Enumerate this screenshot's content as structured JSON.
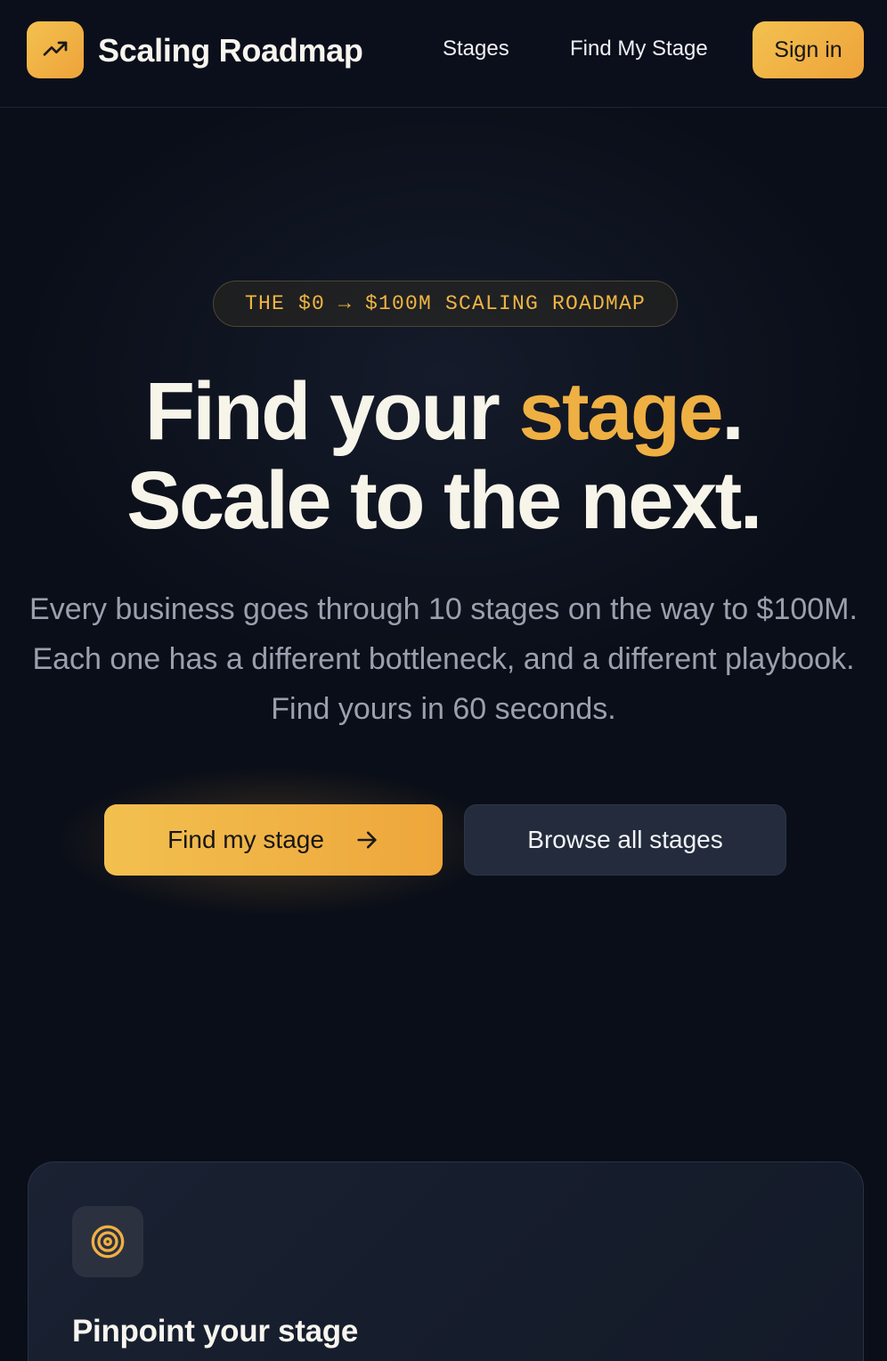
{
  "nav": {
    "brand": "Scaling Roadmap",
    "logo_icon": "trending-up-icon",
    "links": [
      {
        "label": "Stages"
      },
      {
        "label": "Find My Stage"
      }
    ],
    "signin_label": "Sign in"
  },
  "hero": {
    "eyebrow": "THE $0 → $100M SCALING ROADMAP",
    "headline_part1": "Find your ",
    "headline_accent": "stage",
    "headline_part2": ".",
    "headline_line2": "Scale to the next.",
    "subtext": "Every business goes through 10 stages on the way to $100M. Each one has a different bottleneck, and a different playbook. Find yours in 60 seconds.",
    "primary_cta": "Find my stage",
    "primary_cta_icon": "arrow-right-icon",
    "secondary_cta": "Browse all stages"
  },
  "card": {
    "icon": "target-icon",
    "title": "Pinpoint your stage"
  },
  "colors": {
    "background": "#0a0e18",
    "accent": "#efb043",
    "accent_gradient_start": "#f3c14f",
    "accent_gradient_end": "#eea33a",
    "text_primary": "#f7f5ea",
    "text_muted": "#9aa0ad",
    "secondary_button": "#232b3c"
  }
}
